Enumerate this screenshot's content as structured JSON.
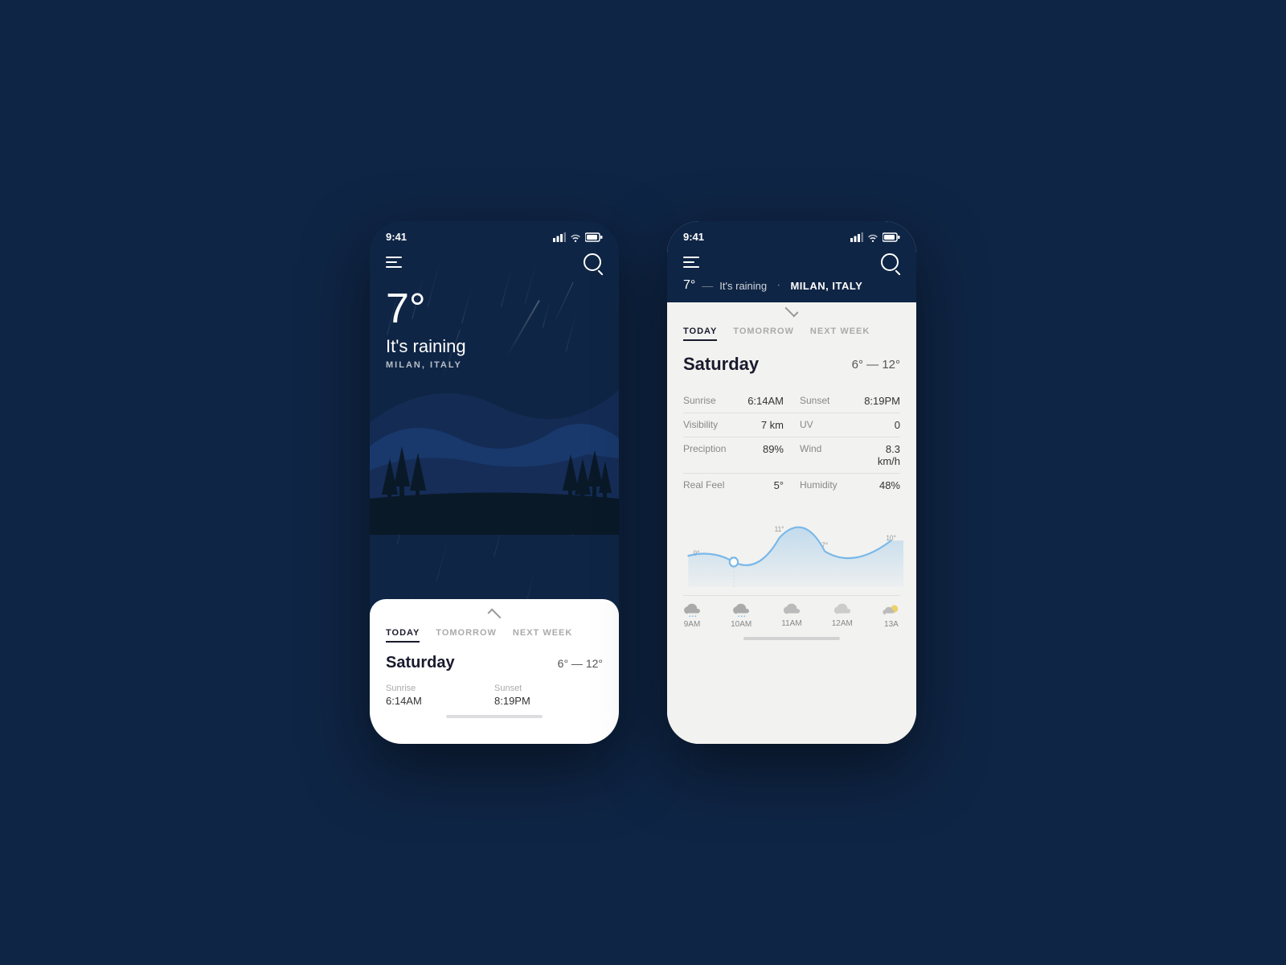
{
  "background": "#0f2545",
  "phone1": {
    "statusBar": {
      "time": "9:41",
      "signal": "▲▲▲",
      "wifi": "wifi",
      "battery": "battery"
    },
    "nav": {
      "menuLabel": "menu",
      "searchLabel": "search"
    },
    "weather": {
      "temperature": "7°",
      "condition": "It's raining",
      "location": "MILAN, ITALY"
    },
    "bottomPanel": {
      "tabs": [
        "TODAY",
        "TOMORROW",
        "NEXT WEEK"
      ],
      "activeTab": 0,
      "day": "Saturday",
      "tempRange": "6° — 12°",
      "details": [
        {
          "label": "Sunrise",
          "value": "6:14AM"
        },
        {
          "label": "Sunset",
          "value": "8:19PM"
        }
      ]
    }
  },
  "phone2": {
    "statusBar": {
      "time": "9:41",
      "signal": "▲▲▲",
      "wifi": "wifi",
      "battery": "battery"
    },
    "header": {
      "temperature": "7°",
      "separator": "—",
      "condition": "It's raining",
      "dot": "·",
      "location": "MILAN, ITALY"
    },
    "nav": {
      "menuLabel": "menu",
      "searchLabel": "search"
    },
    "content": {
      "tabs": [
        "TODAY",
        "TOMORROW",
        "NEXT WEEK"
      ],
      "activeTab": 0,
      "day": "Saturday",
      "tempRange": "6° — 12°",
      "stats": [
        {
          "label": "Sunrise",
          "value": "6:14AM",
          "label2": "Sunset",
          "value2": "8:19PM"
        },
        {
          "label": "Visibility",
          "value": "7 km",
          "label2": "UV",
          "value2": "0"
        },
        {
          "label": "Preciption",
          "value": "89%",
          "label2": "Wind",
          "value2": "8.3 km/h"
        },
        {
          "label": "Real Feel",
          "value": "5°",
          "label2": "Humidity",
          "value2": "48%"
        }
      ],
      "chart": {
        "points": [
          9,
          7,
          11,
          7,
          10
        ],
        "highlightIndex": 1
      },
      "hourly": [
        {
          "time": "9AM",
          "icon": "cloud-rain"
        },
        {
          "time": "10AM",
          "icon": "cloud-rain"
        },
        {
          "time": "11AM",
          "icon": "cloud"
        },
        {
          "time": "12AM",
          "icon": "cloud"
        },
        {
          "time": "13A",
          "icon": "partial-cloud"
        }
      ]
    }
  }
}
